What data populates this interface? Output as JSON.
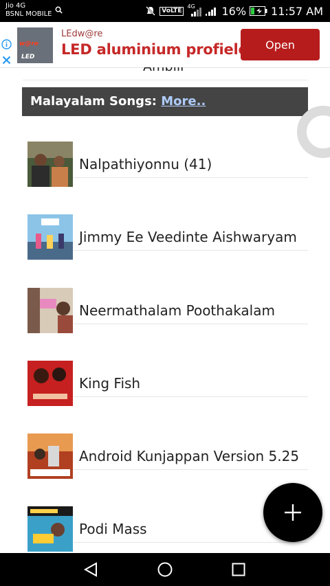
{
  "status_bar": {
    "carrier_line1": "Jio 4G",
    "carrier_line2": "BSNL MOBILE",
    "volte": "VoLTE",
    "network": "4G",
    "battery": "16%",
    "time": "11:57 AM"
  },
  "ad": {
    "logo_text_a": "LED",
    "logo_text_b": "w@re",
    "brand": "LEdw@re",
    "headline": "LED aluminium profielen",
    "cta": "Open"
  },
  "content": {
    "partial_item": "Ambili",
    "section": {
      "label": "Malayalam Songs:",
      "more": "More.."
    },
    "songs": [
      {
        "title": "Nalpathiyonnu (41)"
      },
      {
        "title": "Jimmy Ee Veedinte Aishwaryam"
      },
      {
        "title": "Neermathalam Poothakalam"
      },
      {
        "title": "King Fish"
      },
      {
        "title": "Android Kunjappan Version 5.25"
      },
      {
        "title": "Podi Mass"
      }
    ]
  },
  "fab": {
    "icon": "plus-icon"
  },
  "nav": {
    "back": "back-triangle-icon",
    "home": "home-circle-icon",
    "recent": "recent-square-icon"
  }
}
